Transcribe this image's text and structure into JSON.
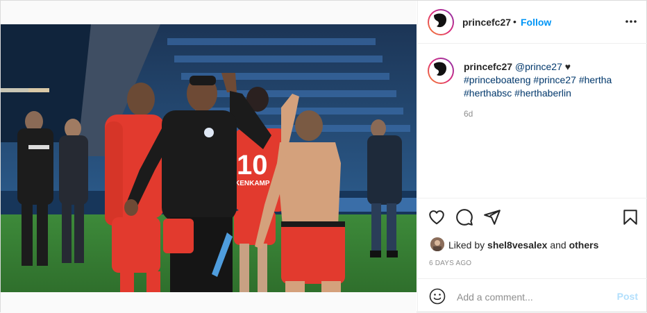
{
  "post": {
    "username": "princefc27",
    "separator": "•",
    "follow_label": "Follow",
    "more_icon": "more-horizontal-icon"
  },
  "caption": {
    "username": "princefc27",
    "mention": "@prince27",
    "heart": "♥",
    "hashtags": [
      "#princeboateng",
      "#prince27",
      "#hertha",
      "#herthabsc",
      "#herthaberlin"
    ],
    "time_ago": "6d"
  },
  "photo": {
    "jersey_number": "10",
    "jersey_name": "KLOKKENKAMP",
    "jersey_name_visible": "KENKAMP"
  },
  "actions": {
    "like_icon": "heart-icon",
    "comment_icon": "comment-icon",
    "share_icon": "share-icon",
    "save_icon": "bookmark-icon"
  },
  "likes": {
    "prefix": "Liked by ",
    "user": "shel8vesalex",
    "middle": " and ",
    "others": "others"
  },
  "date_label": "6 DAYS AGO",
  "comment": {
    "emoji_icon": "emoji-icon",
    "placeholder": "Add a comment...",
    "post_label": "Post"
  },
  "colors": {
    "accent": "#0095f6",
    "link": "#00376b",
    "muted": "#8e8e8e",
    "post_disabled": "#b2dffc"
  }
}
